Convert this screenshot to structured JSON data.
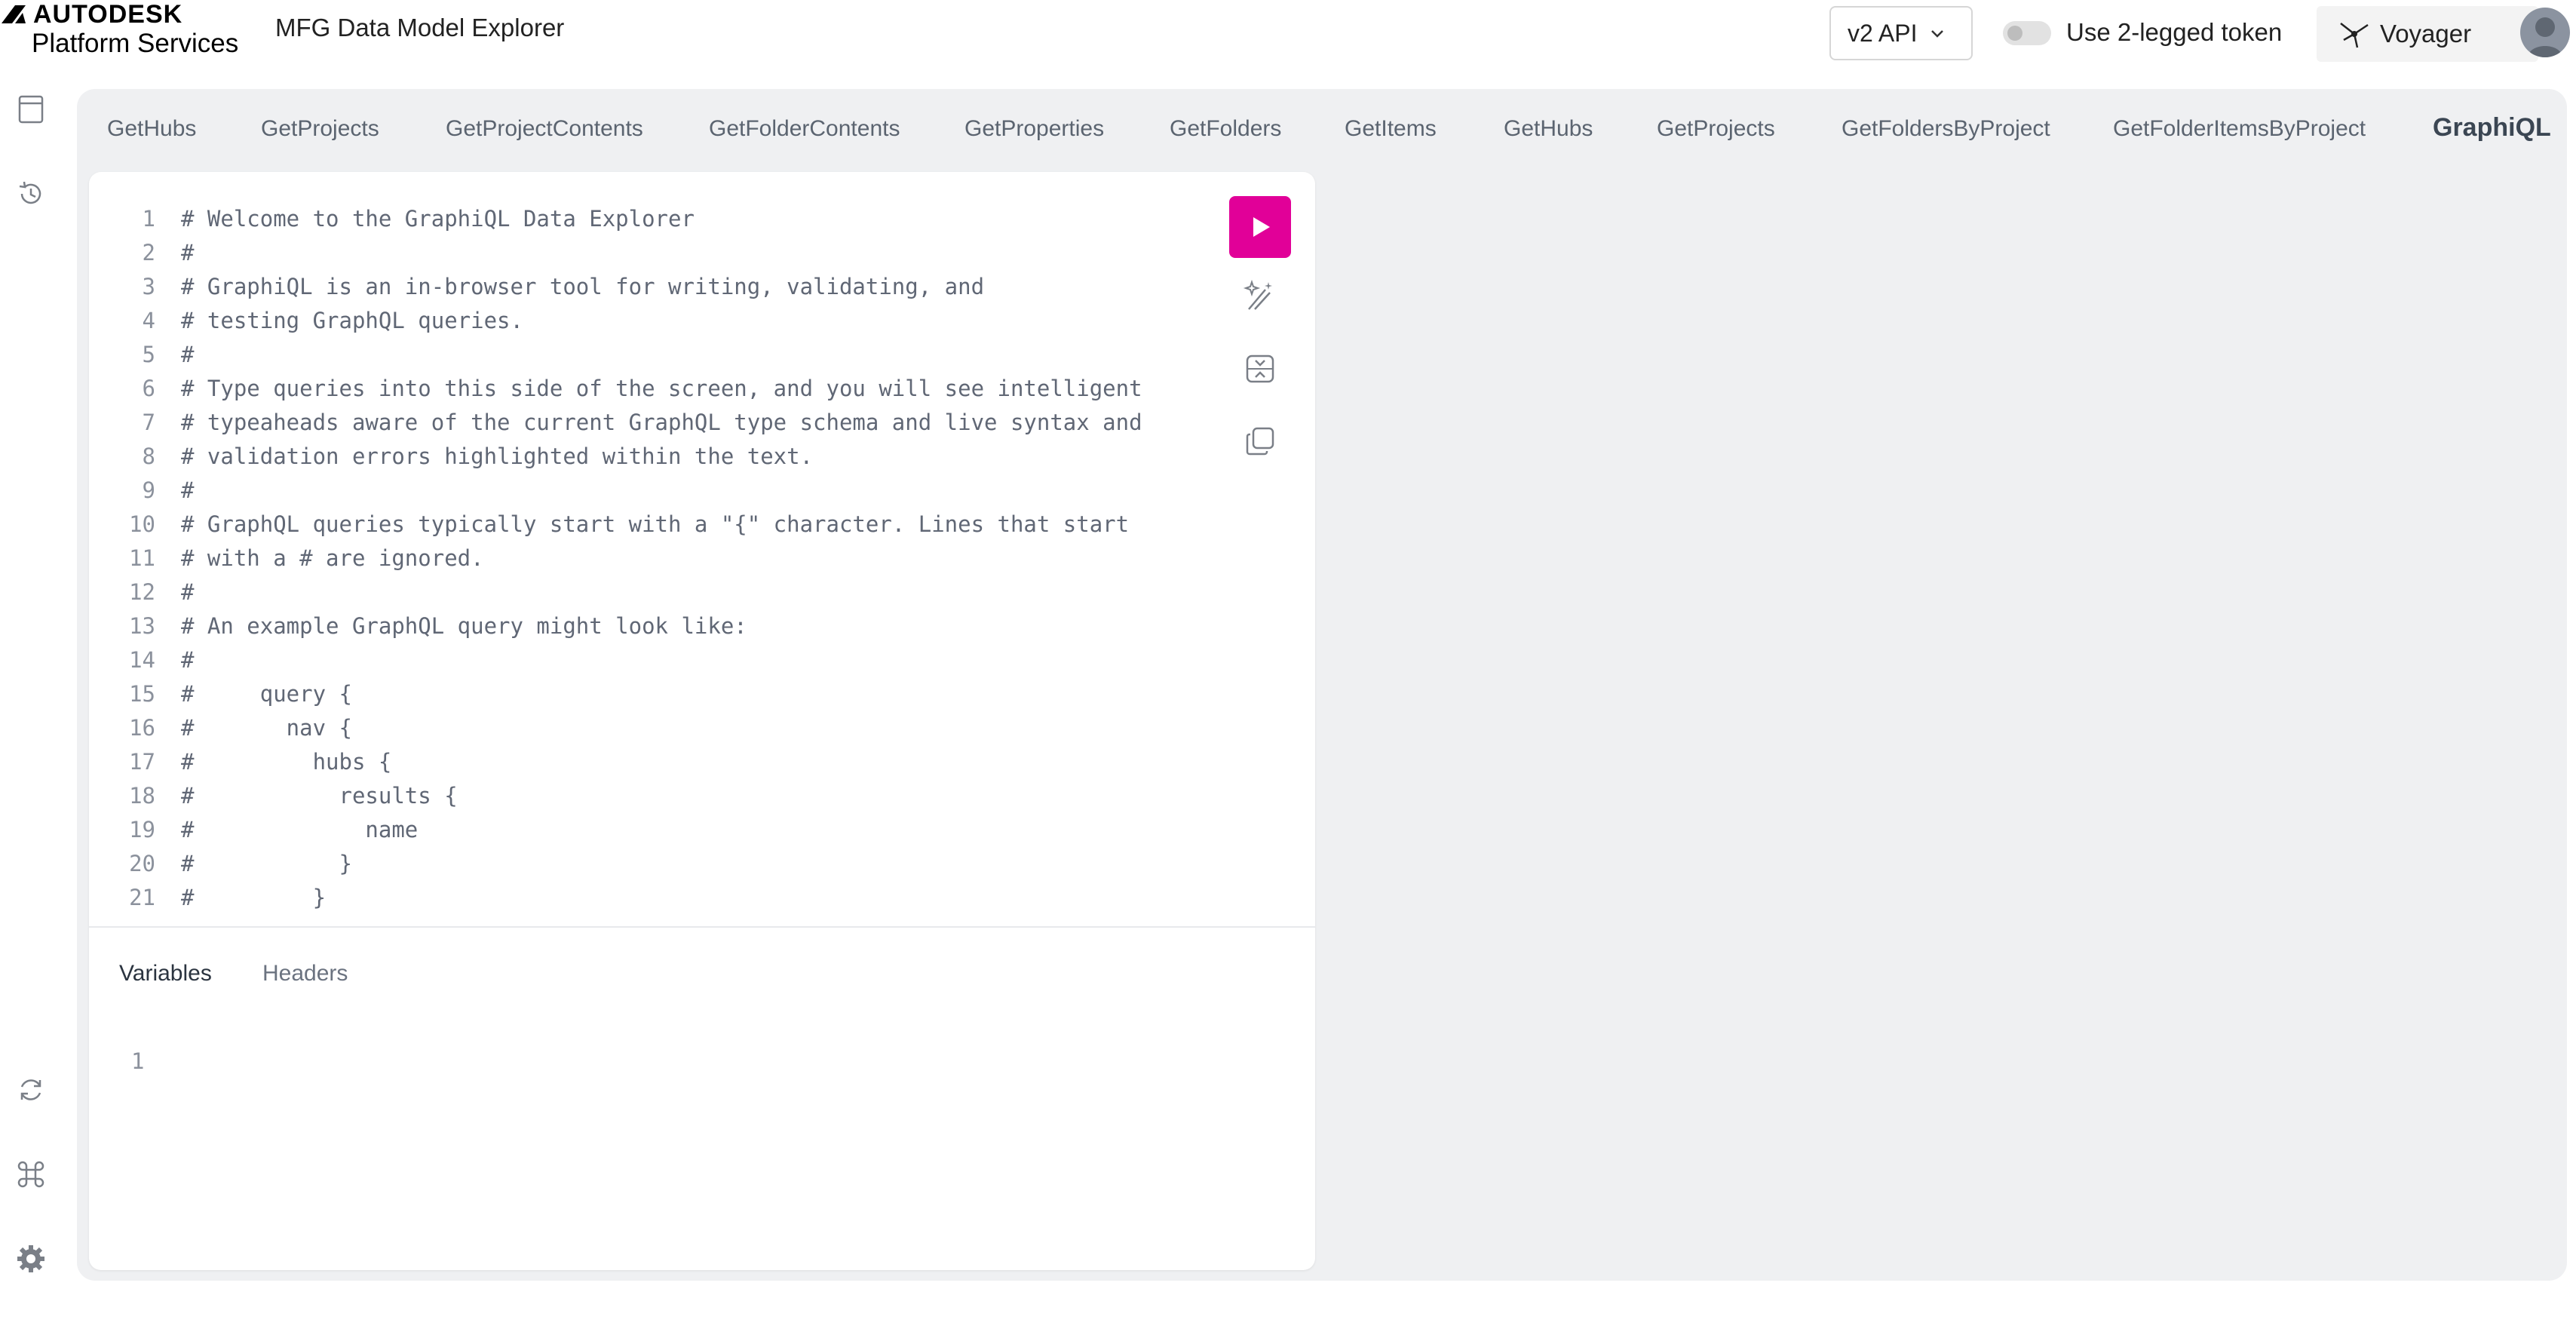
{
  "header": {
    "brand_line1": "AUTODESK",
    "brand_line2": "Platform Services",
    "app_title": "MFG Data Model Explorer",
    "api_select": "v2 API",
    "token_toggle_label": "Use 2-legged token",
    "token_toggle_on": false,
    "voyager_label": "Voyager"
  },
  "tabs": [
    "GetHubs",
    "GetProjects",
    "GetProjectContents",
    "GetFolderContents",
    "GetProperties",
    "GetFolders",
    "GetItems",
    "GetHubs",
    "GetProjects",
    "GetFoldersByProject",
    "GetFolderItemsByProject"
  ],
  "brand_tab": "GraphiQL",
  "editor": {
    "lines": [
      {
        "n": "1",
        "text": "# Welcome to the GraphiQL Data Explorer"
      },
      {
        "n": "2",
        "text": "#"
      },
      {
        "n": "3",
        "text": "# GraphiQL is an in-browser tool for writing, validating, and"
      },
      {
        "n": "4",
        "text": "# testing GraphQL queries."
      },
      {
        "n": "5",
        "text": "#"
      },
      {
        "n": "6",
        "text": "# Type queries into this side of the screen, and you will see intelligent"
      },
      {
        "n": "7",
        "text": "# typeaheads aware of the current GraphQL type schema and live syntax and"
      },
      {
        "n": "8",
        "text": "# validation errors highlighted within the text."
      },
      {
        "n": "9",
        "text": "#"
      },
      {
        "n": "10",
        "text": "# GraphQL queries typically start with a \"{\" character. Lines that start"
      },
      {
        "n": "11",
        "text": "# with a # are ignored."
      },
      {
        "n": "12",
        "text": "#"
      },
      {
        "n": "13",
        "text": "# An example GraphQL query might look like:"
      },
      {
        "n": "14",
        "text": "#"
      },
      {
        "n": "15",
        "text": "#     query {"
      },
      {
        "n": "16",
        "text": "#       nav {"
      },
      {
        "n": "17",
        "text": "#         hubs {"
      },
      {
        "n": "18",
        "text": "#           results {"
      },
      {
        "n": "19",
        "text": "#             name"
      },
      {
        "n": "20",
        "text": "#           }"
      },
      {
        "n": "21",
        "text": "#         }"
      }
    ]
  },
  "bottom_tabs": {
    "variables": "Variables",
    "headers": "Headers"
  },
  "variables_line_number": "1",
  "colors": {
    "run_button": "#e10098",
    "panel_bg": "#eff0f2"
  },
  "icons": {
    "rail_top": [
      "docs-icon",
      "history-icon"
    ],
    "rail_bottom": [
      "refresh-icon",
      "command-icon",
      "settings-icon"
    ],
    "toolbar": [
      "run-icon",
      "prettify-icon",
      "merge-icon",
      "copy-icon"
    ]
  }
}
